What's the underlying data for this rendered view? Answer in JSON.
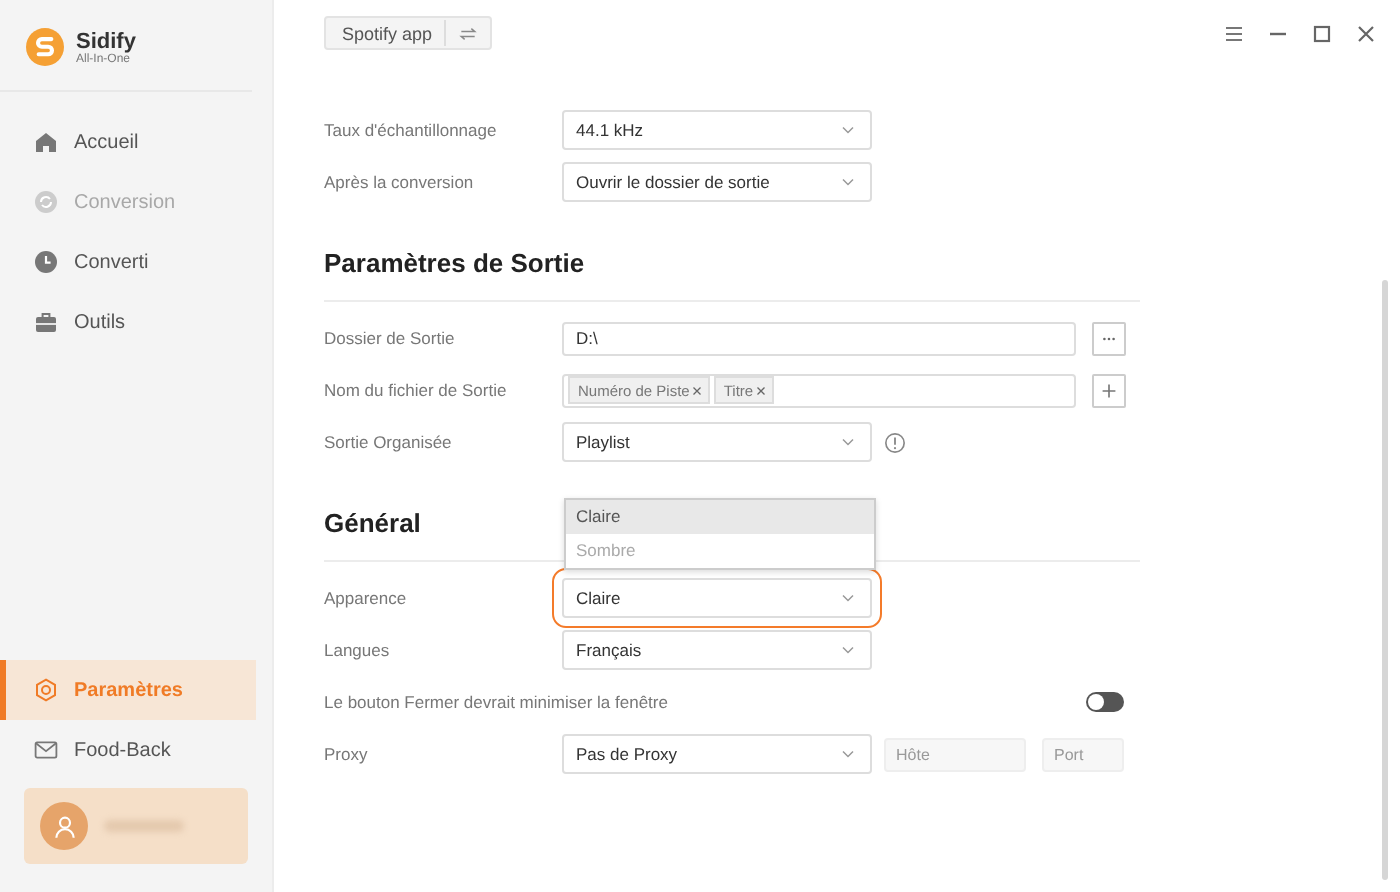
{
  "app": {
    "name": "Sidify",
    "subtitle": "All-In-One"
  },
  "sidebar": {
    "items": [
      {
        "label": "Accueil",
        "selected": false,
        "disabled": false
      },
      {
        "label": "Conversion",
        "selected": false,
        "disabled": true
      },
      {
        "label": "Converti",
        "selected": false,
        "disabled": false
      },
      {
        "label": "Outils",
        "selected": false,
        "disabled": false
      }
    ],
    "bottom_items": [
      {
        "label": "Paramètres",
        "selected": true,
        "disabled": false
      },
      {
        "label": "Food-Back",
        "selected": false,
        "disabled": false
      }
    ]
  },
  "source_button": {
    "label": "Spotify app"
  },
  "sections": [
    {
      "rows": [
        {
          "kind": "select",
          "label": "Taux d'échantillonnage",
          "value": "44.1 kHz"
        },
        {
          "kind": "select",
          "label": "Après la conversion",
          "value": "Ouvrir le dossier de sortie"
        }
      ]
    },
    {
      "title": "Paramètres de Sortie",
      "rows": [
        {
          "kind": "path",
          "label": "Dossier de Sortie",
          "value": "D:\\"
        },
        {
          "kind": "tags",
          "label": "Nom du fichier de Sortie",
          "tags": [
            "Numéro de Piste",
            "Titre"
          ]
        },
        {
          "kind": "select",
          "label": "Sortie Organisée",
          "value": "Playlist",
          "has_info": true
        }
      ]
    },
    {
      "title": "Général",
      "rows": [
        {
          "kind": "select",
          "label": "Apparence",
          "value": "Claire",
          "focused": true,
          "options": [
            {
              "label": "Claire",
              "selected": true
            },
            {
              "label": "Sombre",
              "selected": false
            }
          ]
        },
        {
          "kind": "select",
          "label": "Langues",
          "value": "Français"
        },
        {
          "kind": "toggle",
          "label": "Le bouton Fermer devrait minimiser la fenêtre",
          "on": false
        },
        {
          "kind": "proxy",
          "label": "Proxy",
          "value": "Pas de Proxy",
          "host_placeholder": "Hôte",
          "port_placeholder": "Port"
        }
      ]
    }
  ]
}
